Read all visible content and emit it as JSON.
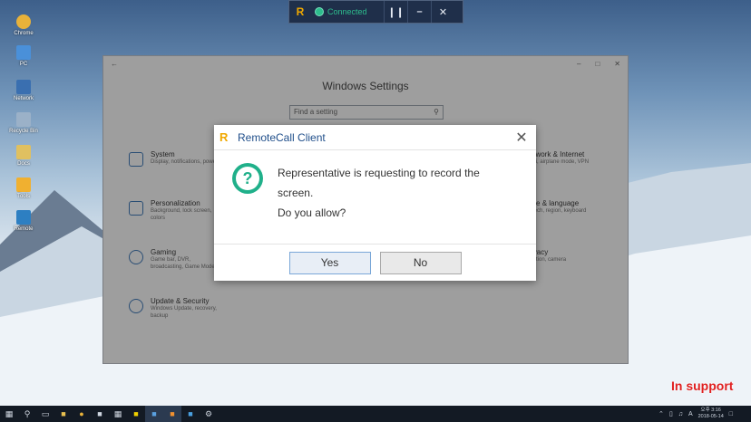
{
  "desktop": {
    "icons": [
      {
        "label": "Chrome",
        "color": "#e8b23a"
      },
      {
        "label": "PC",
        "color": "#4a90d9"
      },
      {
        "label": "Network",
        "color": "#3a6fb0"
      },
      {
        "label": "Recycle Bin",
        "color": "#9bb1c8"
      },
      {
        "label": "Docs",
        "color": "#e0c060"
      },
      {
        "label": "Tools",
        "color": "#f0b030"
      },
      {
        "label": "Remote",
        "color": "#2d7fc2"
      }
    ]
  },
  "rc_toolbar": {
    "status": "Connected",
    "pause_icon": "pause-icon",
    "minimize_icon": "minimize-icon",
    "close_icon": "close-icon"
  },
  "settings": {
    "title": "Windows Settings",
    "search_placeholder": "Find a setting",
    "items": [
      {
        "title": "System",
        "desc": "Display, notifications, power"
      },
      {
        "title": "Personalization",
        "desc": "Background, lock screen, colors"
      },
      {
        "title": "Gaming",
        "desc": "Game bar, DVR, broadcasting, Game Mode"
      },
      {
        "title": "Update & Security",
        "desc": "Windows Update, recovery, backup"
      },
      {
        "title": "Network & Internet",
        "desc": "Wi-Fi, airplane mode, VPN"
      },
      {
        "title": "Time & language",
        "desc": "Speech, region, keyboard"
      },
      {
        "title": "Privacy",
        "desc": "Location, camera"
      }
    ]
  },
  "dialog": {
    "title": "RemoteCall Client",
    "message_line1": "Representative is requesting to record the screen.",
    "message_line2": "Do you allow?",
    "yes_label": "Yes",
    "no_label": "No",
    "accent": "#20b08a"
  },
  "in_support": "In support",
  "taskbar": {
    "time": "오후 3:16",
    "date": "2018-05-14",
    "ime": "A"
  }
}
